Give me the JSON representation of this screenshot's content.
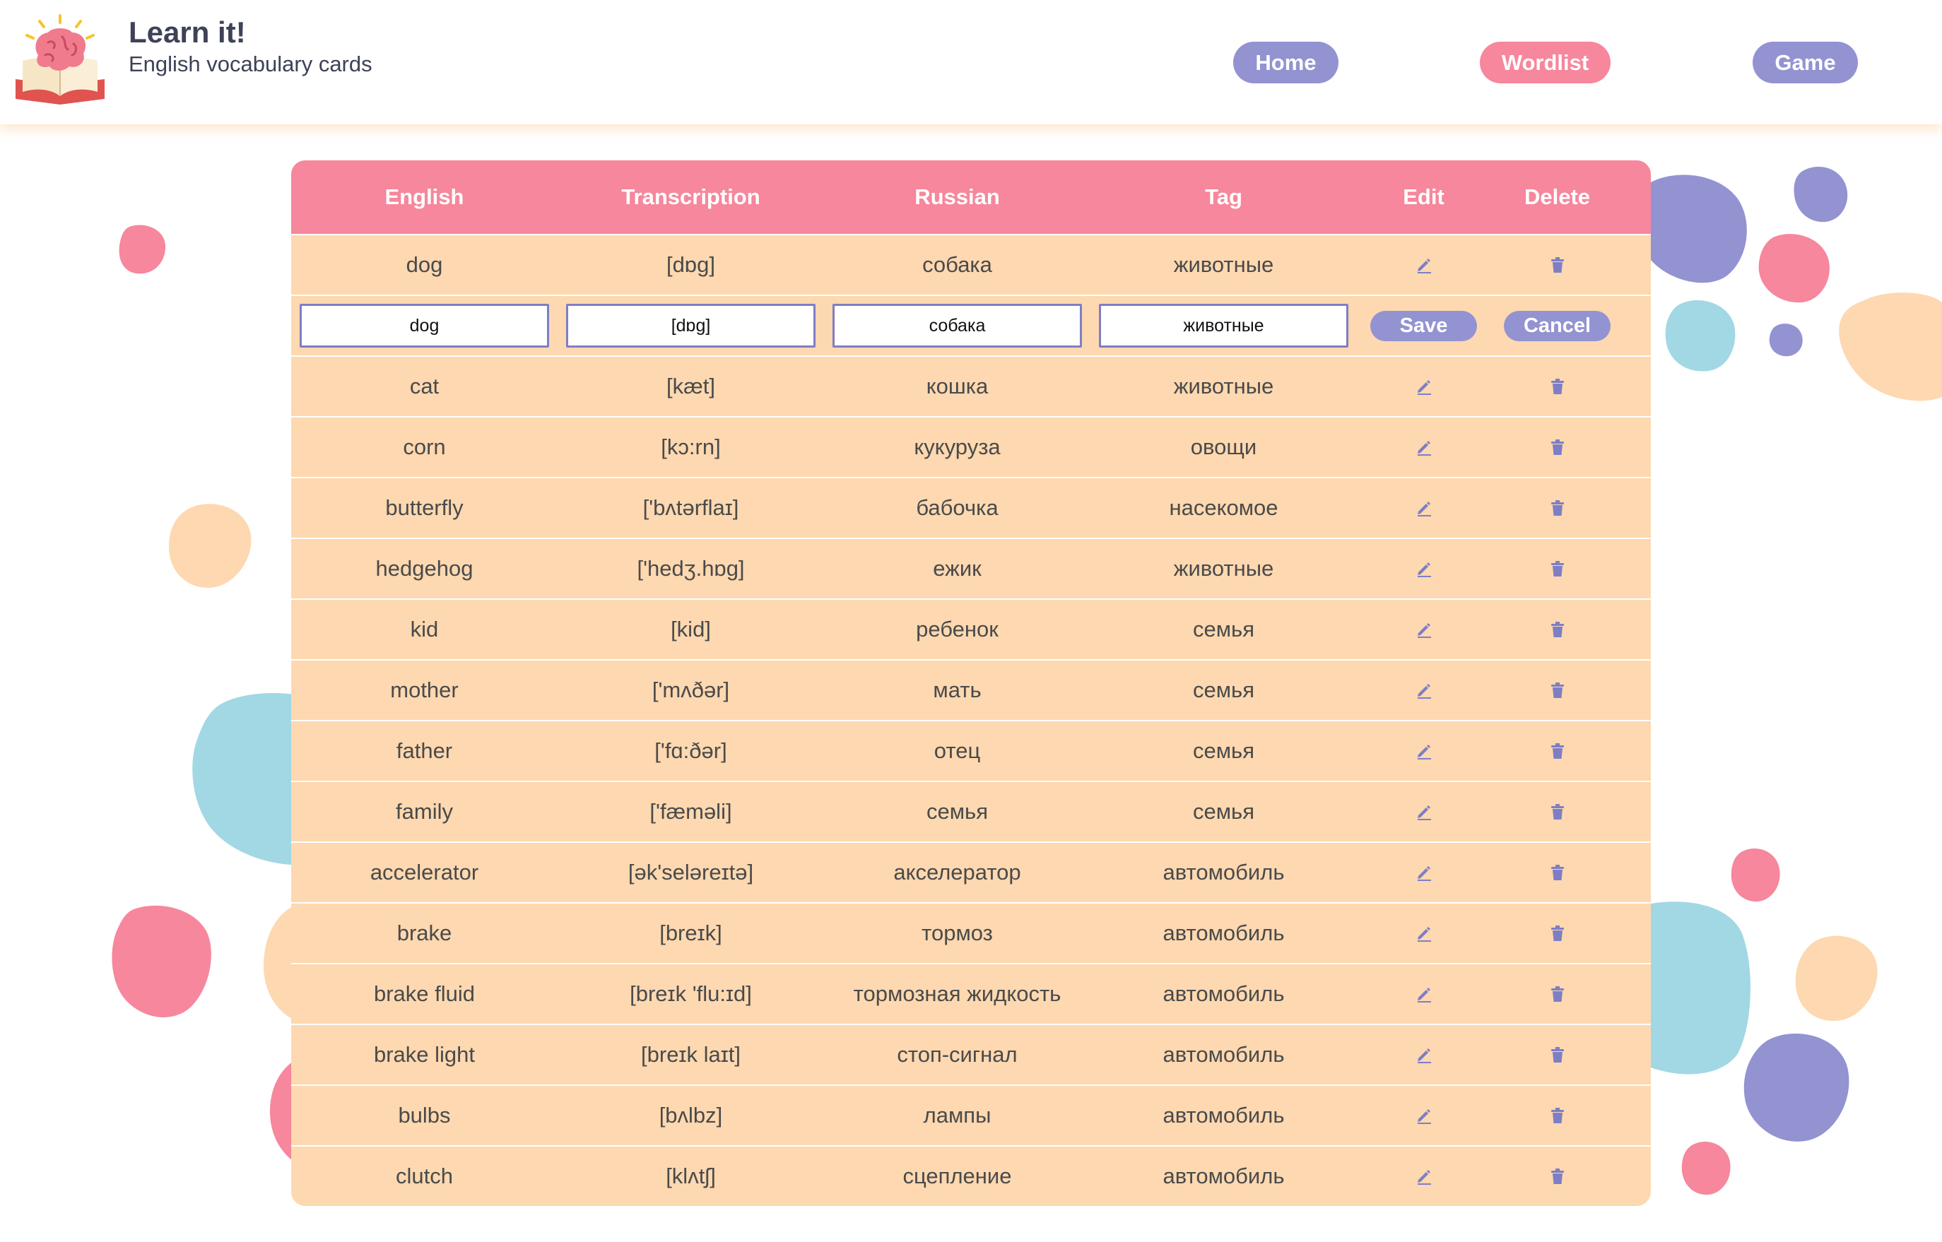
{
  "app": {
    "title": "Learn it!",
    "subtitle": "English vocabulary cards",
    "logo": "book-brain-logo"
  },
  "nav": [
    {
      "label": "Home",
      "color": "#9393d2"
    },
    {
      "label": "Wordlist",
      "color": "#f6879c",
      "active": true
    },
    {
      "label": "Game",
      "color": "#9393d2"
    }
  ],
  "table": {
    "headers": [
      "English",
      "Transcription",
      "Russian",
      "Tag",
      "Edit",
      "Delete"
    ],
    "edit_icon": "pencil-icon",
    "delete_icon": "trash-icon",
    "rows_before_edit": [
      {
        "english": "dog",
        "transcription": "[dɒɡ]",
        "russian": "собака",
        "tag": "животные"
      }
    ],
    "edit_row": {
      "english": "dog",
      "transcription": "[dɒɡ]",
      "russian": "собака",
      "tag": "животные",
      "save_label": "Save",
      "cancel_label": "Cancel"
    },
    "rows_after_edit": [
      {
        "english": "cat",
        "transcription": "[kæt]",
        "russian": "кошка",
        "tag": "животные"
      },
      {
        "english": "corn",
        "transcription": "[kɔ:rn]",
        "russian": "кукуруза",
        "tag": "овощи"
      },
      {
        "english": "butterfly",
        "transcription": "['bʌtərflaɪ]",
        "russian": "бабочка",
        "tag": "насекомое"
      },
      {
        "english": "hedgehog",
        "transcription": "['hedʒ.hɒɡ]",
        "russian": "ежик",
        "tag": "животные"
      },
      {
        "english": "kid",
        "transcription": "[kid]",
        "russian": "ребенок",
        "tag": "семья"
      },
      {
        "english": "mother",
        "transcription": "['mʌðər]",
        "russian": "мать",
        "tag": "семья"
      },
      {
        "english": "father",
        "transcription": "['fɑ:ðər]",
        "russian": "отец",
        "tag": "семья"
      },
      {
        "english": "family",
        "transcription": "['fæməli]",
        "russian": "семья",
        "tag": "семья"
      },
      {
        "english": "accelerator",
        "transcription": "[ək'seləreɪtə]",
        "russian": "акселератор",
        "tag": "автомобиль"
      },
      {
        "english": "brake",
        "transcription": "[breɪk]",
        "russian": "тормоз",
        "tag": "автомобиль"
      },
      {
        "english": "brake fluid",
        "transcription": "[breɪk 'flu:ɪd]",
        "russian": "тормозная жидкость",
        "tag": "автомобиль"
      },
      {
        "english": "brake light",
        "transcription": "[breɪk laɪt]",
        "russian": "стоп-сигнал",
        "tag": "автомобиль"
      },
      {
        "english": "bulbs",
        "transcription": "[bʌlbz]",
        "russian": "лампы",
        "tag": "автомобиль"
      },
      {
        "english": "clutch",
        "transcription": "[klʌtʃ]",
        "russian": "сцепление",
        "tag": "автомобиль"
      }
    ]
  },
  "colors": {
    "pink": "#f6879c",
    "lavender": "#9393d2",
    "peach": "#fdd8b0",
    "cyan": "#a1d8e4"
  }
}
